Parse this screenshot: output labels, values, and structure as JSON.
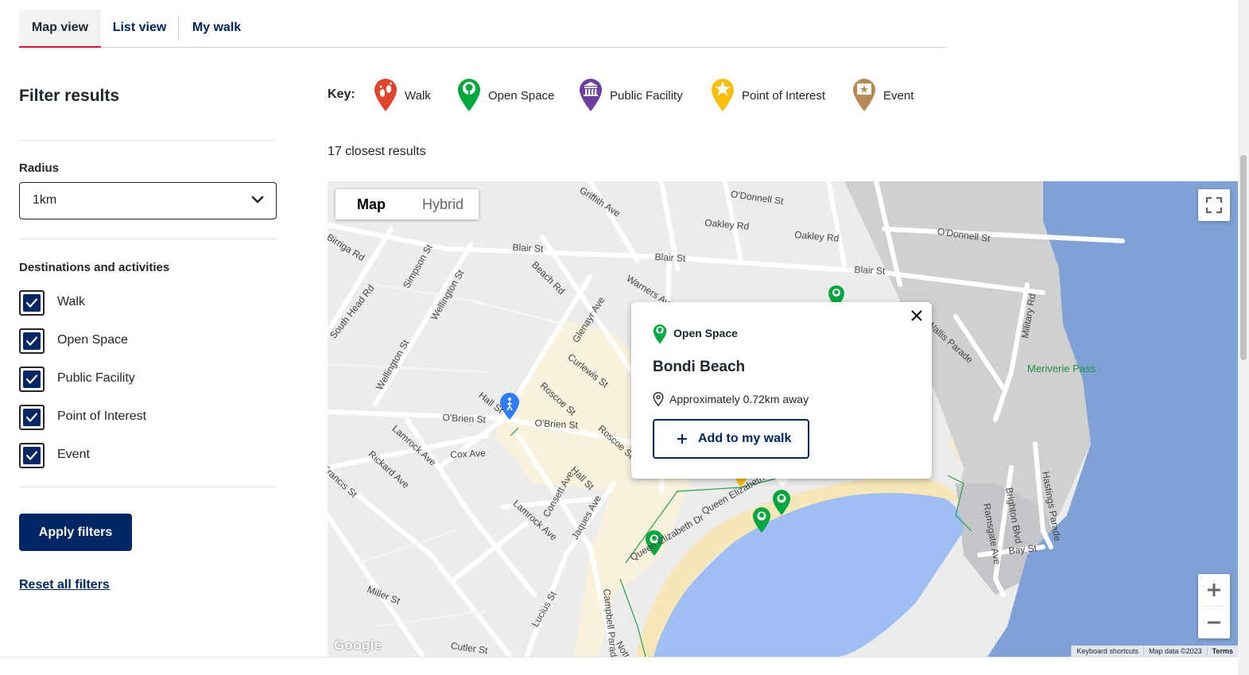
{
  "tabs": [
    {
      "label": "Map view",
      "active": true
    },
    {
      "label": "List view",
      "active": false
    },
    {
      "label": "My walk",
      "active": false
    }
  ],
  "filters": {
    "title": "Filter results",
    "radius_label": "Radius",
    "radius_value": "1km",
    "destinations_label": "Destinations and activities",
    "options": [
      {
        "label": "Walk",
        "checked": true
      },
      {
        "label": "Open Space",
        "checked": true
      },
      {
        "label": "Public Facility",
        "checked": true
      },
      {
        "label": "Point of Interest",
        "checked": true
      },
      {
        "label": "Event",
        "checked": true
      }
    ],
    "apply_label": "Apply filters",
    "reset_label": "Reset all filters"
  },
  "key": {
    "label": "Key:",
    "items": [
      {
        "label": "Walk",
        "icon": "walk-pin-icon",
        "color": "#e0442a"
      },
      {
        "label": "Open Space",
        "icon": "open-space-pin-icon",
        "color": "#00a63e"
      },
      {
        "label": "Public Facility",
        "icon": "public-facility-pin-icon",
        "color": "#6b3fa0"
      },
      {
        "label": "Point of Interest",
        "icon": "point-of-interest-pin-icon",
        "color": "#fbbd0b"
      },
      {
        "label": "Event",
        "icon": "event-pin-icon",
        "color": "#b58a55"
      }
    ]
  },
  "results_count": "17 closest results",
  "map": {
    "map_type_options": [
      "Map",
      "Hybrid"
    ],
    "selected_map_type": "Map",
    "attribution": [
      "Keyboard shortcuts",
      "Map data ©2023",
      "Terms"
    ],
    "google_logo": "Google",
    "labels": {
      "griffith": "Griffith Ave",
      "odonnell1": "O'Donnell St",
      "oakley1": "Oakley Rd",
      "oakley2": "Oakley Rd",
      "odonnell2": "O'Donnell St",
      "birriga": "Birriga Rd",
      "blair1": "Blair St",
      "blair2": "Blair St",
      "blair3": "Blair St",
      "beach": "Beach Rd",
      "warners": "Warners Ave",
      "simpson": "Simpson St",
      "wellington1": "Wellington St",
      "wellington2": "Wellington St",
      "southhead": "South Head Rd",
      "glenayr": "Glenayr Ave",
      "curlewis": "Curlewis St",
      "roscoe1": "Roscoe St",
      "roscoe2": "Roscoe St",
      "hall1": "Hall St",
      "hall2": "Hall St",
      "obrien1": "O'Brien St",
      "obrien2": "O'Brien St",
      "lamrock1": "Lamrock Ave",
      "lamrock2": "Lamrock Ave",
      "cox": "Cox Ave",
      "rickard": "Rickard Ave",
      "francis": "Francis St",
      "consett": "Consett Ave",
      "jaques": "Jaques Ave",
      "queenelizabeth1": "Queen Elizabeth Dr",
      "queenelizabeth2": "Queen Elizabeth Dr",
      "campbell": "Campbell Parade",
      "miller": "Miller St",
      "lucius": "Lucius St",
      "cutler": "Cutler St",
      "notts": "Notts Ave",
      "military": "Military Rd",
      "wallis": "Wallis Parade",
      "meriverie": "Meriverie Pass",
      "ramsgate": "Ramsgate Ave",
      "brighton": "Brighton Blvd",
      "hastings": "Hastings Parade",
      "bay": "Bay St"
    }
  },
  "popup": {
    "category": "Open Space",
    "title": "Bondi Beach",
    "distance": "Approximately 0.72km away",
    "add_label": "Add to my walk"
  }
}
